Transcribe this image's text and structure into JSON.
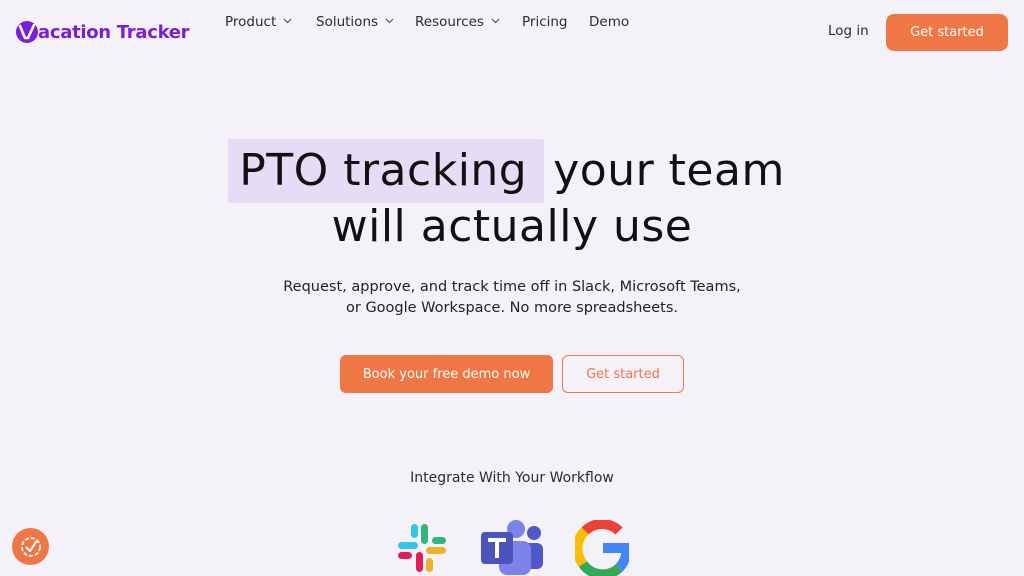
{
  "brand": {
    "name": "acation Tracker",
    "logo_letter": "V",
    "color": "#7a1fd6"
  },
  "nav": {
    "items": [
      {
        "label": "Product",
        "dropdown": true
      },
      {
        "label": "Solutions",
        "dropdown": true
      },
      {
        "label": "Resources",
        "dropdown": true
      },
      {
        "label": "Pricing",
        "dropdown": false
      },
      {
        "label": "Demo",
        "dropdown": false
      }
    ],
    "login": "Log in",
    "cta": "Get started"
  },
  "hero": {
    "title_highlight": "PTO tracking",
    "title_rest": "your team",
    "title_line2": "will actually use",
    "subtitle_line1": "Request, approve, and track time off in Slack, Microsoft Teams,",
    "subtitle_line2": "or Google Workspace. No more spreadsheets.",
    "primary_cta": "Book your free demo now",
    "secondary_cta": "Get started"
  },
  "integrations": {
    "heading": "Integrate With Your Workflow",
    "icons": [
      "slack-icon",
      "microsoft-teams-icon",
      "google-icon"
    ]
  },
  "colors": {
    "accent": "#ef7745",
    "highlight": "#e7dcf6",
    "background": "#f4f1f8"
  }
}
